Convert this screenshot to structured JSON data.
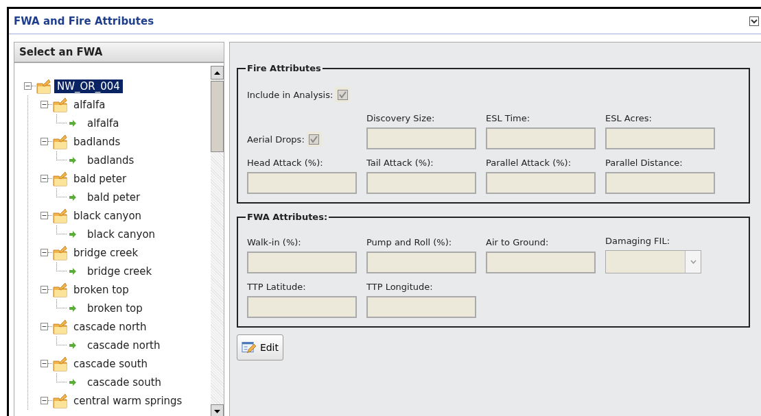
{
  "window": {
    "title": "FWA and Fire Attributes",
    "collapsed": false
  },
  "tree_panel": {
    "title": "Select an FWA",
    "tree": [
      {
        "label": "NW_OR_004",
        "kind": "folder",
        "selected": true,
        "expanded": true,
        "children": [
          {
            "label": "alfalfa",
            "kind": "folder",
            "selected": false,
            "expanded": true,
            "children": [
              {
                "label": "alfalfa",
                "kind": "leaf",
                "selected": false
              }
            ]
          },
          {
            "label": "badlands",
            "kind": "folder",
            "selected": false,
            "expanded": true,
            "children": [
              {
                "label": "badlands",
                "kind": "leaf",
                "selected": false
              }
            ]
          },
          {
            "label": "bald peter",
            "kind": "folder",
            "selected": false,
            "expanded": true,
            "children": [
              {
                "label": "bald peter",
                "kind": "leaf",
                "selected": false
              }
            ]
          },
          {
            "label": "black canyon",
            "kind": "folder",
            "selected": false,
            "expanded": true,
            "children": [
              {
                "label": "black canyon",
                "kind": "leaf",
                "selected": false
              }
            ]
          },
          {
            "label": "bridge creek",
            "kind": "folder",
            "selected": false,
            "expanded": true,
            "children": [
              {
                "label": "bridge creek",
                "kind": "leaf",
                "selected": false
              }
            ]
          },
          {
            "label": "broken top",
            "kind": "folder",
            "selected": false,
            "expanded": true,
            "children": [
              {
                "label": "broken top",
                "kind": "leaf",
                "selected": false
              }
            ]
          },
          {
            "label": "cascade north",
            "kind": "folder",
            "selected": false,
            "expanded": true,
            "children": [
              {
                "label": "cascade north",
                "kind": "leaf",
                "selected": false
              }
            ]
          },
          {
            "label": "cascade south",
            "kind": "folder",
            "selected": false,
            "expanded": true,
            "children": [
              {
                "label": "cascade south",
                "kind": "leaf",
                "selected": false
              }
            ]
          },
          {
            "label": "central warm springs",
            "kind": "folder",
            "selected": false,
            "expanded": true
          }
        ]
      }
    ]
  },
  "fire_attributes": {
    "title": "Fire Attributes",
    "rows": [
      [
        {
          "kind": "checkbox",
          "label": "Include in Analysis:",
          "checked": true,
          "disabled": true
        }
      ],
      [
        {
          "kind": "checkbox",
          "label": "Aerial Drops:",
          "checked": true,
          "disabled": true
        },
        {
          "kind": "text",
          "label": "Discovery Size:",
          "disabled": true
        },
        {
          "kind": "text",
          "label": "ESL Time:",
          "disabled": true
        },
        {
          "kind": "text",
          "label": "ESL Acres:",
          "disabled": true
        }
      ],
      [
        {
          "kind": "text",
          "label": "Head Attack (%):",
          "disabled": true
        },
        {
          "kind": "text",
          "label": "Tail Attack (%):",
          "disabled": true
        },
        {
          "kind": "text",
          "label": "Parallel Attack (%):",
          "disabled": true
        },
        {
          "kind": "text",
          "label": "Parallel Distance:",
          "disabled": true
        }
      ]
    ]
  },
  "fwa_attributes": {
    "title": "FWA Attributes:",
    "rows": [
      [
        {
          "kind": "text",
          "label": "Walk-in (%):",
          "disabled": true
        },
        {
          "kind": "text",
          "label": "Pump and Roll (%):",
          "disabled": true
        },
        {
          "kind": "text",
          "label": "Air to Ground:",
          "disabled": true
        },
        {
          "kind": "select",
          "label": "Damaging FIL:",
          "disabled": true
        }
      ],
      [
        {
          "kind": "text",
          "label": "TTP Latitude:",
          "disabled": true
        },
        {
          "kind": "text",
          "label": "TTP Longitude:",
          "disabled": true
        }
      ]
    ]
  },
  "buttons": [
    {
      "label": "Edit"
    }
  ]
}
